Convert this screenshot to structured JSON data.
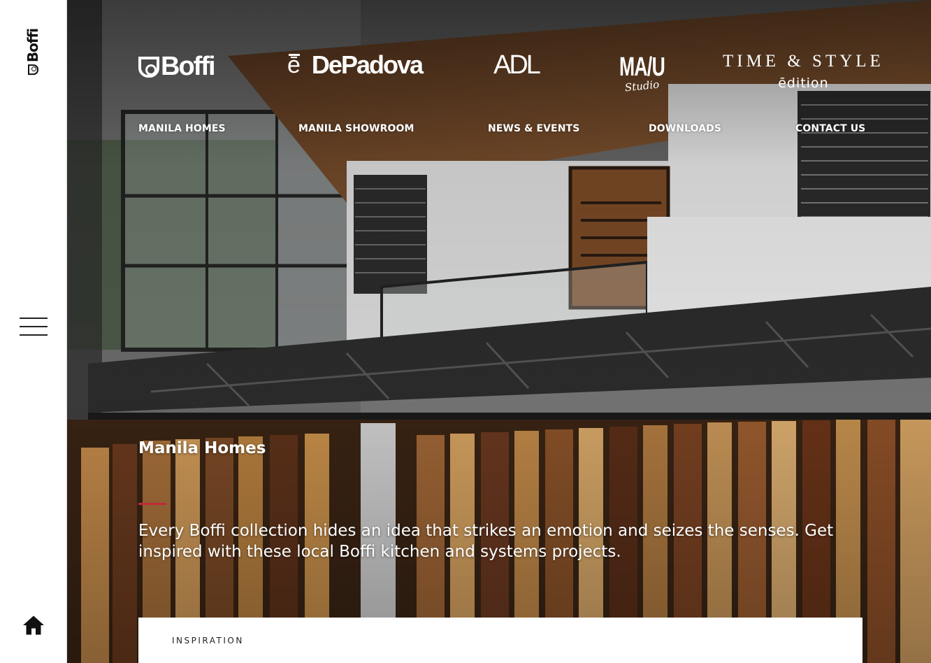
{
  "rail": {
    "logo_text": "Boffi",
    "menu_icon": "hamburger-menu-icon",
    "home_icon": "home-icon"
  },
  "brands": {
    "boffi": "Boffi",
    "depadova_mark": "ē",
    "depadova": "DePadova",
    "adl": "ADL",
    "mau": "MA/U",
    "mau_sub": "Studio",
    "time_style": "TIME & STYLE",
    "time_style_sub": "ēdition"
  },
  "nav": {
    "items": [
      "MANILA HOMES",
      "MANILA SHOWROOM",
      "NEWS & EVENTS",
      "DOWNLOADS",
      "CONTACT US"
    ]
  },
  "hero": {
    "title": "Manila Homes",
    "description": "Every Boffi collection hides an idea that strikes an emotion and seizes the senses. Get inspired with these local Boffi kitchen and systems projects.",
    "accent_color": "#c12a36"
  },
  "card": {
    "label": "INSPIRATION"
  }
}
